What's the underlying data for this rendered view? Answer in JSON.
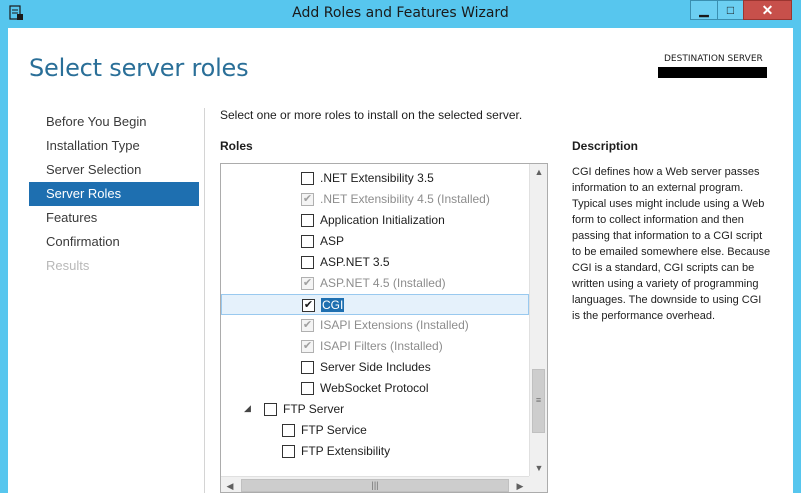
{
  "window": {
    "title": "Add Roles and Features Wizard",
    "minimize_label": "▁",
    "maximize_label": "□",
    "close_label": "✕"
  },
  "header": {
    "title": "Select server roles",
    "destination_label": "DESTINATION SERVER"
  },
  "nav": {
    "items": [
      {
        "label": "Before You Begin",
        "state": "normal"
      },
      {
        "label": "Installation Type",
        "state": "normal"
      },
      {
        "label": "Server Selection",
        "state": "normal"
      },
      {
        "label": "Server Roles",
        "state": "active"
      },
      {
        "label": "Features",
        "state": "normal"
      },
      {
        "label": "Confirmation",
        "state": "normal"
      },
      {
        "label": "Results",
        "state": "disabled"
      }
    ]
  },
  "main": {
    "intro": "Select one or more roles to install on the selected server.",
    "roles_heading": "Roles",
    "roles": [
      {
        "label": ".NET Extensibility 3.5",
        "checked": false,
        "disabled": false,
        "level": 3
      },
      {
        "label": ".NET Extensibility 4.5 (Installed)",
        "checked": true,
        "disabled": true,
        "level": 3
      },
      {
        "label": "Application Initialization",
        "checked": false,
        "disabled": false,
        "level": 3
      },
      {
        "label": "ASP",
        "checked": false,
        "disabled": false,
        "level": 3
      },
      {
        "label": "ASP.NET 3.5",
        "checked": false,
        "disabled": false,
        "level": 3
      },
      {
        "label": "ASP.NET 4.5 (Installed)",
        "checked": true,
        "disabled": true,
        "level": 3
      },
      {
        "label": "CGI",
        "checked": true,
        "disabled": false,
        "level": 3,
        "selected": true
      },
      {
        "label": "ISAPI Extensions (Installed)",
        "checked": true,
        "disabled": true,
        "level": 3
      },
      {
        "label": "ISAPI Filters (Installed)",
        "checked": true,
        "disabled": true,
        "level": 3
      },
      {
        "label": "Server Side Includes",
        "checked": false,
        "disabled": false,
        "level": 3
      },
      {
        "label": "WebSocket Protocol",
        "checked": false,
        "disabled": false,
        "level": 3
      },
      {
        "label": "FTP Server",
        "checked": false,
        "disabled": false,
        "level": 1,
        "expander": "◢"
      },
      {
        "label": "FTP Service",
        "checked": false,
        "disabled": false,
        "level": 2
      },
      {
        "label": "FTP Extensibility",
        "checked": false,
        "disabled": false,
        "level": 2
      }
    ],
    "description_heading": "Description",
    "description": "CGI defines how a Web server passes information to an external program. Typical uses might include using a Web form to collect information and then passing that information to a CGI script to be emailed somewhere else. Because CGI is a standard, CGI scripts can be written using a variety of programming languages. The downside to using CGI is the performance overhead."
  },
  "scrollbars": {
    "up": "▲",
    "down": "▼",
    "left": "◀",
    "right": "▶",
    "vgrip": "≡",
    "hgrip": "|||"
  },
  "colors": {
    "titlebar": "#57c6ee",
    "accent": "#1e6fb0",
    "heading": "#2a6f98",
    "close": "#c7504b"
  }
}
